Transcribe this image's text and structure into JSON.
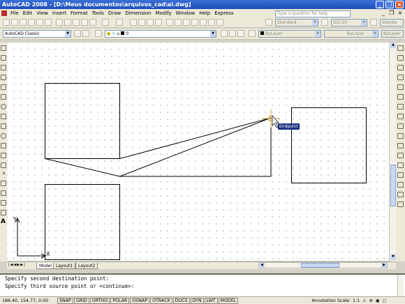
{
  "title": "AutoCAD 2008 - [D:\\Meus documentos\\arquivos_cad\\al.dwg]",
  "window_controls": [
    "_",
    "❐",
    "×"
  ],
  "menu": [
    "File",
    "Edit",
    "View",
    "Insert",
    "Format",
    "Tools",
    "Draw",
    "Dimension",
    "Modify",
    "Window",
    "Help",
    "Express"
  ],
  "help_search": {
    "placeholder": "Type a question for help"
  },
  "toolbar2": {
    "workspace": "AutoCAD Classic",
    "layer": "0",
    "text_style": "Standard",
    "dim_style": "ISO-25",
    "table_style": "Standa",
    "color": "ByLayer",
    "linetype": "ByLayer",
    "lineweight": "ByLayer"
  },
  "tooltip": {
    "endpoint": "Endpoint"
  },
  "ucs": {
    "x": "X",
    "y": "Y"
  },
  "tabs": [
    "Model",
    "Layout1",
    "Layout2"
  ],
  "command_lines": [
    "Specify second destination point:",
    "Specify third source point or <continue>:"
  ],
  "status": {
    "coords": "186.40, 154.77, 0.00",
    "buttons": [
      "SNAP",
      "GRID",
      "ORTHO",
      "POLAR",
      "OSNAP",
      "OTRACK",
      "DUCS",
      "DYN",
      "LWT",
      "MODEL"
    ],
    "annotation_scale_label": "Annotation Scale:",
    "annotation_scale_value": "1:1"
  }
}
